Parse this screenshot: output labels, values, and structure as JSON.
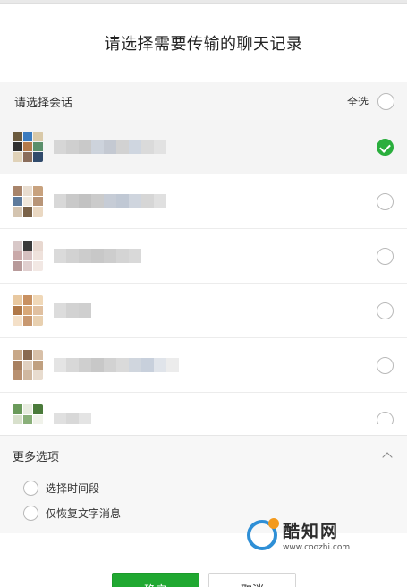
{
  "dialog": {
    "title": "请选择需要传输的聊天记录"
  },
  "conversation_section": {
    "label": "请选择会话",
    "select_all_label": "全选",
    "select_all_checked": false
  },
  "conversations": [
    {
      "checked": true,
      "avatar_colors": [
        "#6b5a3e",
        "#3a7bbf",
        "#d9c9a8",
        "#2f2f2f",
        "#b47a4a",
        "#5a8f6b",
        "#e0d2b8",
        "#8a6d5b",
        "#304a6b"
      ],
      "blur_colors": [
        "#d6d6d6",
        "#cfcfcf",
        "#c9c9c9",
        "#cdd3dc",
        "#c4c9d2",
        "#d2d2d2",
        "#cfd6e0",
        "#dadada",
        "#e2e2e2"
      ]
    },
    {
      "checked": false,
      "avatar_colors": [
        "#a8846a",
        "#e8ddd0",
        "#c8a27e",
        "#5e7b9c",
        "#f0e8dc",
        "#b89578",
        "#d4c4b0",
        "#7a6248",
        "#ead8c2"
      ],
      "blur_colors": [
        "#d8d8d8",
        "#c9c9c9",
        "#c2c2c2",
        "#cbcbcb",
        "#c6ccd6",
        "#c0c8d4",
        "#cfd5de",
        "#d6d6d6",
        "#e0e0e0"
      ]
    },
    {
      "checked": false,
      "avatar_colors": [
        "#d8c8c8",
        "#3a3a3a",
        "#e8d8d0",
        "#c9a9a9",
        "#d6c0c0",
        "#efe2dc",
        "#b89a9a",
        "#e0cfcf",
        "#f2e8e4"
      ],
      "blur_colors": [
        "#dadada",
        "#d2d2d2",
        "#cccccc",
        "#c8c8c8",
        "#cdcdcd",
        "#d4d4d4",
        "#d9d9d9"
      ]
    },
    {
      "checked": false,
      "avatar_colors": [
        "#e8c8a0",
        "#c89060",
        "#f0d8b8",
        "#b07848",
        "#d8a878",
        "#e0c0a0",
        "#f4e0c8",
        "#c89870",
        "#e8d0b0"
      ],
      "blur_colors": [
        "#dcdcdc",
        "#d2d2d2",
        "#cfcfcf"
      ]
    },
    {
      "checked": false,
      "avatar_colors": [
        "#c8a888",
        "#8a6a50",
        "#d8c0a8",
        "#a88060",
        "#e0d0c0",
        "#c0a080",
        "#b89070",
        "#d0b8a0",
        "#e8dccf"
      ],
      "blur_colors": [
        "#e4e4e4",
        "#d8d8d8",
        "#cfcfcf",
        "#c8c8c8",
        "#d2d2d2",
        "#dadada",
        "#d0d6de",
        "#c8d0dc",
        "#e0e4ea",
        "#ececec"
      ]
    },
    {
      "checked": false,
      "avatar_colors": [
        "#6a9a5a",
        "#e8ece0",
        "#4a7a3a",
        "#d8e0cc",
        "#8ab07a",
        "#f0f2ea",
        "#5a8a4a",
        "#c8d4b8",
        "#eef0e8"
      ],
      "blur_colors": [
        "#e0e0e0",
        "#d8d8d8",
        "#e4e4e4"
      ]
    }
  ],
  "more_options": {
    "label": "更多选项",
    "expanded": true,
    "options": [
      {
        "label": "选择时间段",
        "checked": false
      },
      {
        "label": "仅恢复文字消息",
        "checked": false
      }
    ]
  },
  "buttons": {
    "confirm_label": "确定",
    "cancel_label": "取消"
  },
  "watermark": {
    "name": "酷知网",
    "url": "www.coozhi.com",
    "logo_ring_color": "#2e8fd6",
    "logo_dot_color": "#f39a1e"
  },
  "colors": {
    "accent_green": "#2aae3d",
    "confirm_green": "#20a831"
  }
}
